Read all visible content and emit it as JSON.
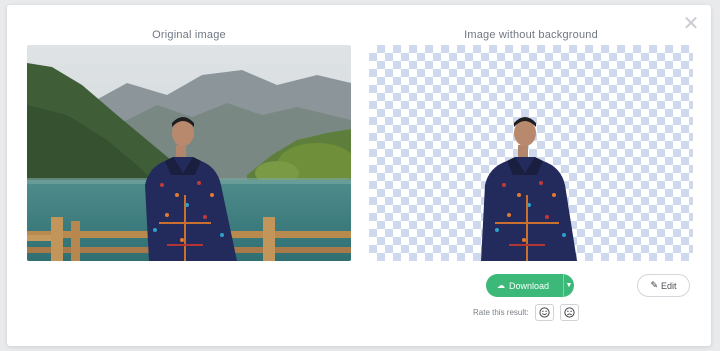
{
  "dialog": {
    "close_icon": "close-icon"
  },
  "captions": {
    "original": "Original image",
    "result": "Image without background"
  },
  "actions": {
    "download_label": "Download",
    "download_icon": "cloud-download-icon",
    "dropdown_icon": "caret-down-icon",
    "edit_label": "Edit",
    "edit_icon": "pencil-icon"
  },
  "rating": {
    "label": "Rate this result:",
    "happy_icon": "smile-face-icon",
    "sad_icon": "sad-face-icon"
  },
  "colors": {
    "download_green": "#3cb878",
    "checker": "#cfd9ee",
    "caption_text": "#707782"
  }
}
